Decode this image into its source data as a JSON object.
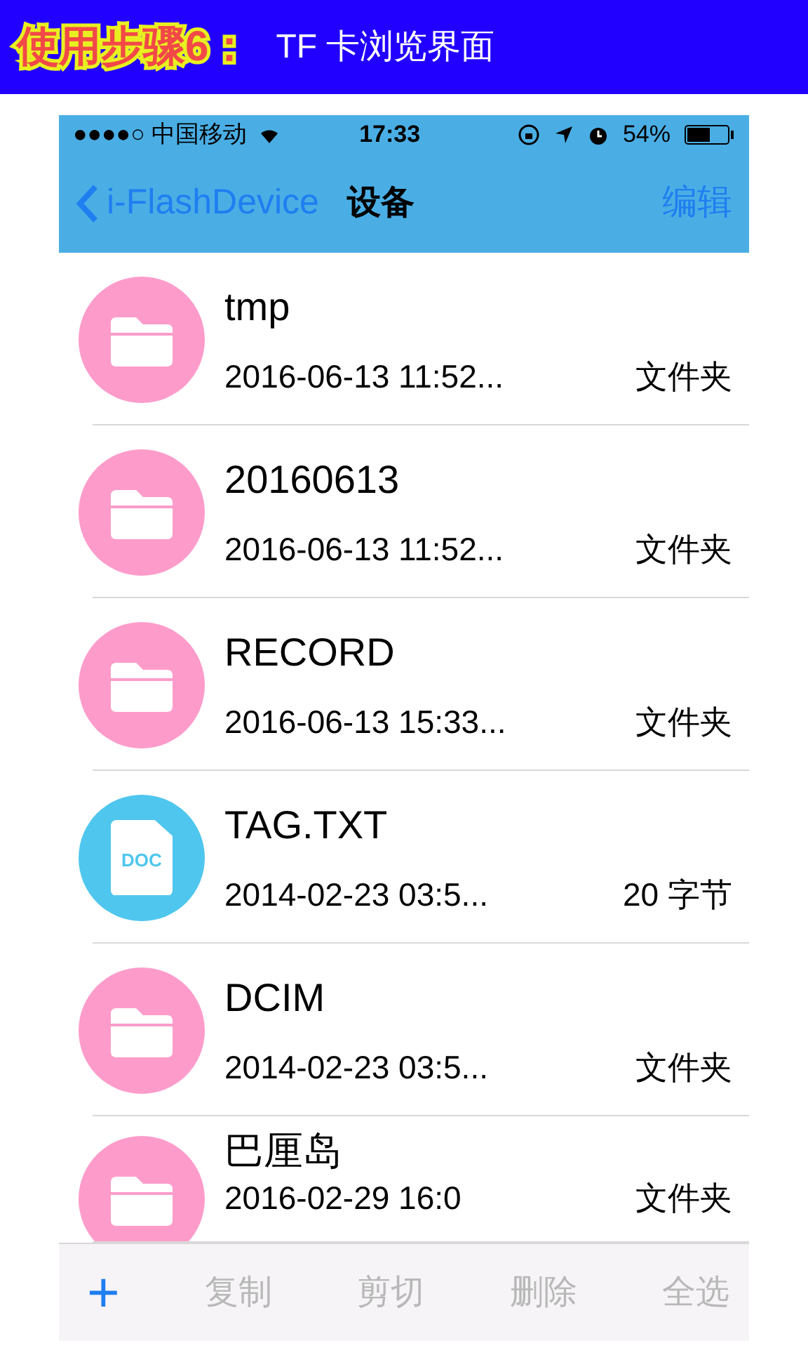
{
  "banner": {
    "step": "使用步骤6：",
    "title": "TF 卡浏览界面"
  },
  "status_bar": {
    "carrier": "●●●●○ 中国移动",
    "time": "17:33",
    "battery": "54%"
  },
  "nav": {
    "back": "i-FlashDevice",
    "title": "设备",
    "action": "编辑"
  },
  "files": [
    {
      "kind": "folder",
      "name": "tmp",
      "date": "2016-06-13 11:52...",
      "info": "文件夹"
    },
    {
      "kind": "folder",
      "name": "20160613",
      "date": "2016-06-13 11:52...",
      "info": "文件夹"
    },
    {
      "kind": "folder",
      "name": "RECORD",
      "date": "2016-06-13 15:33...",
      "info": "文件夹"
    },
    {
      "kind": "doc",
      "name": "TAG.TXT",
      "date": "2014-02-23 03:5...",
      "info": "20 字节",
      "badge": "DOC"
    },
    {
      "kind": "folder",
      "name": "DCIM",
      "date": "2014-02-23 03:5...",
      "info": "文件夹"
    },
    {
      "kind": "folder",
      "name": "巴厘岛",
      "date": "2016-02-29 16:0",
      "info": "文件夹"
    }
  ],
  "toolbar": {
    "add": "+",
    "buttons": [
      "复制",
      "剪切",
      "删除",
      "全选"
    ]
  }
}
